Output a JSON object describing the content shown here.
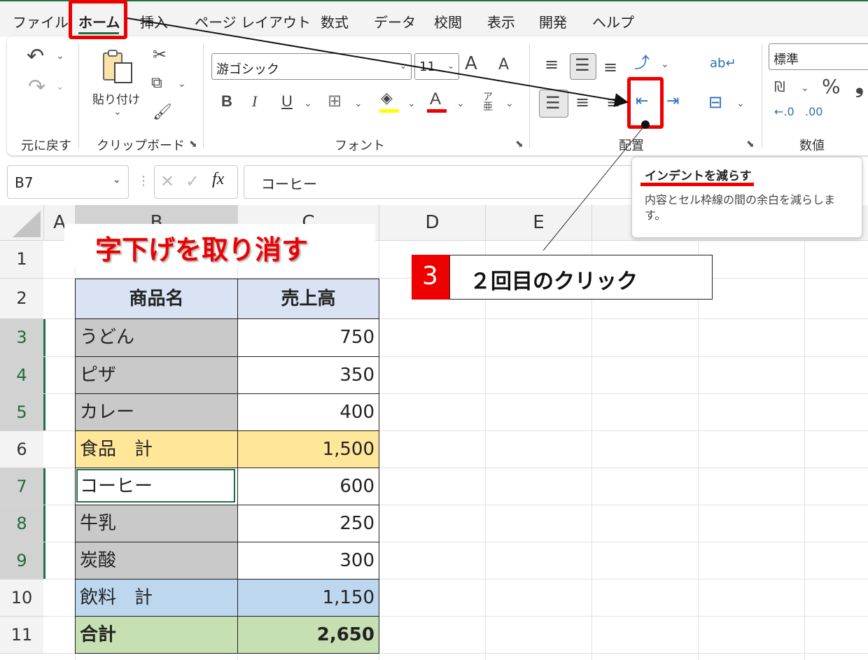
{
  "menu": {
    "items": [
      "ファイル",
      "ホーム",
      "挿入",
      "ページ レイアウト",
      "数式",
      "データ",
      "校閲",
      "表示",
      "開発",
      "ヘルプ"
    ],
    "active": "ホーム"
  },
  "ribbon": {
    "undo_group_label": "元に戻す",
    "paste_label": "貼り付け",
    "clipboard_group_label": "クリップボード",
    "font_name": "游ゴシック",
    "font_size": "11",
    "font_group_label": "フォント",
    "alignment_group_label": "配置",
    "number_format": "標準",
    "number_group_label": "数値",
    "bold": "B",
    "italic": "I",
    "underline": "U",
    "grow_font": "A",
    "shrink_font": "A",
    "font_color_letter": "A",
    "percent": "%",
    "comma": "❟"
  },
  "formula_bar": {
    "name_box": "B7",
    "fx": "fx",
    "content": "コーヒー"
  },
  "tooltip": {
    "title": "インデントを減らす",
    "body": "内容とセル枠線の間の余白を減らします。"
  },
  "annotation": {
    "title": "字下げを取り消す",
    "step_number": "3",
    "step_text": "２回目のクリック"
  },
  "sheet": {
    "columns": [
      "A",
      "B",
      "C",
      "D",
      "E"
    ],
    "rows": [
      "1",
      "2",
      "3",
      "4",
      "5",
      "6",
      "7",
      "8",
      "9",
      "10",
      "11"
    ],
    "table": {
      "headers": [
        "商品名",
        "売上高"
      ],
      "rows": [
        {
          "name": "うどん",
          "value": "750"
        },
        {
          "name": "ピザ",
          "value": "350"
        },
        {
          "name": "カレー",
          "value": "400"
        },
        {
          "name": "食品　計",
          "value": "1,500"
        },
        {
          "name": "コーヒー",
          "value": "600"
        },
        {
          "name": "牛乳",
          "value": "250"
        },
        {
          "name": "炭酸",
          "value": "300"
        },
        {
          "name": "飲料　計",
          "value": "1,150"
        },
        {
          "name": "合計",
          "value": "2,650"
        }
      ]
    }
  },
  "colors": {
    "excel_green": "#1e7145",
    "highlight_red": "#ee0000",
    "header_fill": "#dae3f3",
    "gray_fill": "#c9c9c9",
    "food_total_fill": "#ffe699",
    "drink_total_fill": "#bdd7ee",
    "grand_total_fill": "#c6e0b4"
  }
}
